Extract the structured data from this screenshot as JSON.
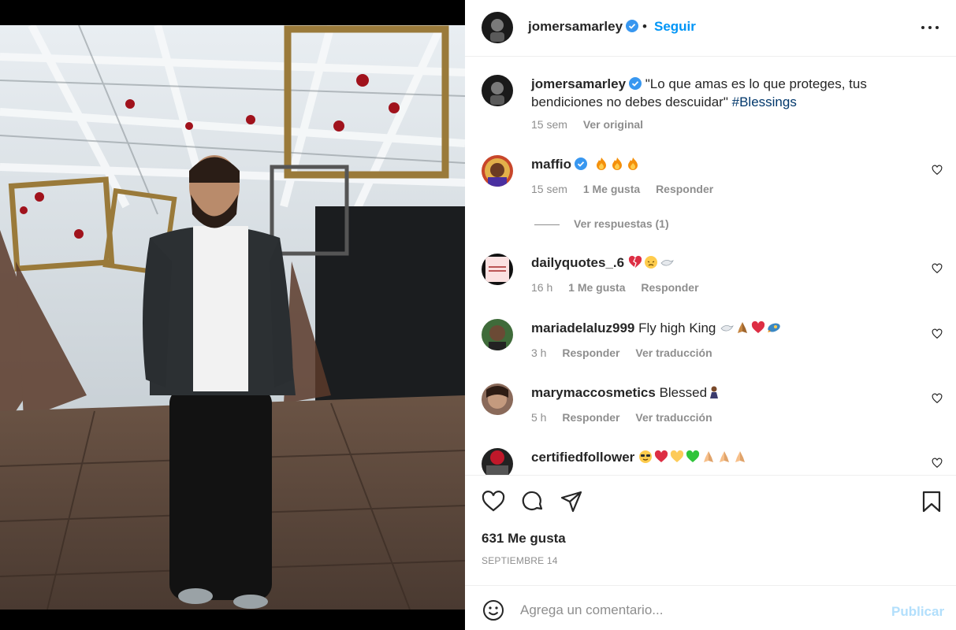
{
  "post": {
    "username": "jomersamarley",
    "follow_label": "Seguir",
    "separator": "•",
    "caption_user": "jomersamarley",
    "caption_text": "\"Lo que amas es lo que proteges, tus bendiciones no debes descuidar\"",
    "caption_hashtag": "#Blessings",
    "caption_age": "15 sem",
    "see_original": "Ver original"
  },
  "comments": [
    {
      "user": "maffio",
      "verified": true,
      "text": "",
      "emojis": [
        "fire",
        "fire",
        "fire"
      ],
      "age": "15 sem",
      "likes": "1 Me gusta",
      "reply": "Responder",
      "view_replies": "Ver respuestas (1)"
    },
    {
      "user": "dailyquotes_.6",
      "verified": false,
      "text": "",
      "emojis": [
        "broken-heart",
        "pensive-face",
        "dove"
      ],
      "age": "16 h",
      "likes": "1 Me gusta",
      "reply": "Responder"
    },
    {
      "user": "mariadelaluz999",
      "verified": false,
      "text": "Fly high King",
      "emojis": [
        "dove",
        "folded-hands",
        "red-heart",
        "rocket"
      ],
      "age": "3 h",
      "reply": "Responder",
      "translate": "Ver traducción"
    },
    {
      "user": "marymaccosmetics",
      "verified": false,
      "text": "Blessed",
      "emojis": [
        "woman-praying"
      ],
      "age": "5 h",
      "reply": "Responder",
      "translate": "Ver traducción"
    },
    {
      "user": "certifiedfollower",
      "verified": false,
      "text": "",
      "emojis": [
        "sunglasses-face",
        "red-heart",
        "yellow-heart",
        "green-heart",
        "folded-hands",
        "folded-hands",
        "folded-hands"
      ]
    }
  ],
  "stats": {
    "likes": "631 Me gusta",
    "date": "SEPTIEMBRE 14"
  },
  "composer": {
    "placeholder": "Agrega un comentario...",
    "publish_label": "Publicar"
  },
  "colors": {
    "accent": "#0095f6",
    "verified": "#3897f0",
    "muted": "#8e8e8e",
    "publish_disabled": "#b2dffc"
  }
}
